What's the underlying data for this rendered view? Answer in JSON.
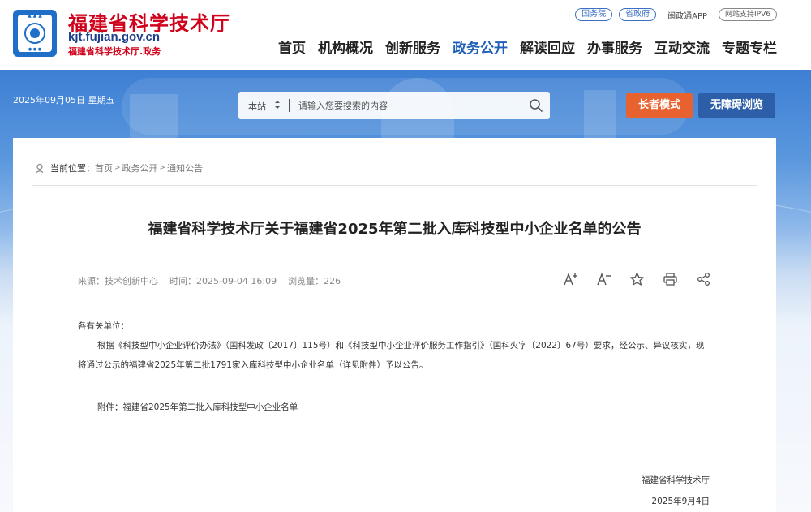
{
  "colors": {
    "brand_red": "#d0021b",
    "brand_blue": "#1f5fb8",
    "elder_btn": "#e8622f",
    "access_btn": "#2d5fa8"
  },
  "logo": {
    "emblem_icon": "emblem-icon",
    "title": "福建省科学技术厅",
    "domain": "kjt.fujian.gov.cn",
    "subtitle": "福建省科学技术厅.政务"
  },
  "top_links": {
    "state_council": "国务院",
    "provincial_gov": "省政府",
    "app": "闽政通APP",
    "ipv6": "网站支持IPV6"
  },
  "nav": [
    {
      "label": "首页"
    },
    {
      "label": "机构概况"
    },
    {
      "label": "创新服务"
    },
    {
      "label": "政务公开"
    },
    {
      "label": "解读回应"
    },
    {
      "label": "办事服务"
    },
    {
      "label": "互动交流"
    },
    {
      "label": "专题专栏"
    }
  ],
  "banner": {
    "date": "2025年09月05日  星期五"
  },
  "search": {
    "scope": "本站",
    "placeholder": "请输入您要搜索的内容"
  },
  "mode_buttons": {
    "elder": "长者模式",
    "accessible": "无障碍浏览"
  },
  "breadcrumb": {
    "label": "当前位置：",
    "items": [
      "首页",
      "政务公开",
      "通知公告"
    ]
  },
  "article": {
    "title": "福建省科学技术厅关于福建省2025年第二批入库科技型中小企业名单的公告",
    "meta": {
      "source": "来源：技术创新中心",
      "time": "时间：2025-09-04 16:09",
      "views": "浏览量：226"
    },
    "salutation": "各有关单位：",
    "paragraph": "根据《科技型中小企业评价办法》（国科发政〔2017〕115号）和《科技型中小企业评价服务工作指引》（国科火字〔2022〕67号）要求，经公示、异议核实，现将通过公示的福建省2025年第二批1791家入库科技型中小企业名单（详见附件）予以公告。",
    "attachment": "附件：福建省2025年第二批入库科技型中小企业名单",
    "signature": "福建省科学技术厅",
    "date": "2025年9月4日"
  }
}
